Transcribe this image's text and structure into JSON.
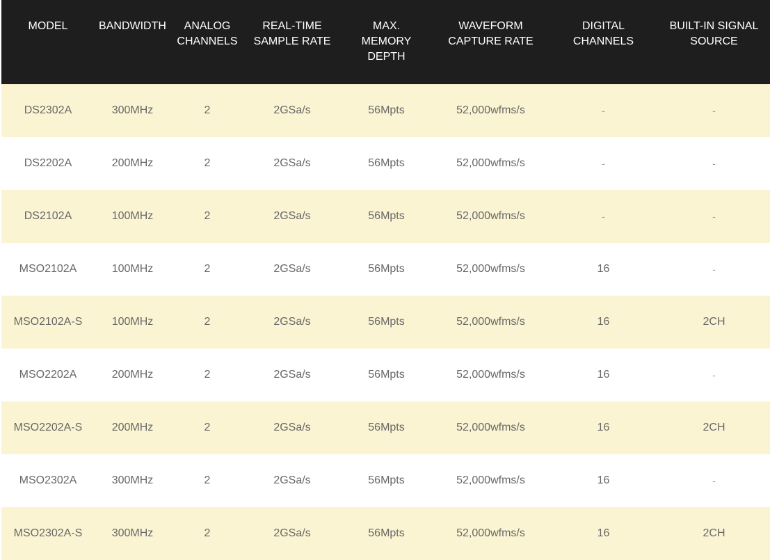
{
  "table": {
    "headers": [
      "MODEL",
      "BANDWIDTH",
      "ANALOG\nCHANNELS",
      "REAL-TIME\nSAMPLE RATE",
      "MAX.\nMEMORY\nDEPTH",
      "WAVEFORM\nCAPTURE RATE",
      "DIGITAL\nCHANNELS",
      "BUILT-IN SIGNAL\nSOURCE"
    ],
    "rows": [
      [
        "DS2302A",
        "300MHz",
        "2",
        "2GSa/s",
        "56Mpts",
        "52,000wfms/s",
        "-",
        "-"
      ],
      [
        "DS2202A",
        "200MHz",
        "2",
        "2GSa/s",
        "56Mpts",
        "52,000wfms/s",
        "-",
        "-"
      ],
      [
        "DS2102A",
        "100MHz",
        "2",
        "2GSa/s",
        "56Mpts",
        "52,000wfms/s",
        "-",
        "-"
      ],
      [
        "MSO2102A",
        "100MHz",
        "2",
        "2GSa/s",
        "56Mpts",
        "52,000wfms/s",
        "16",
        "-"
      ],
      [
        "MSO2102A-S",
        "100MHz",
        "2",
        "2GSa/s",
        "56Mpts",
        "52,000wfms/s",
        "16",
        "2CH"
      ],
      [
        "MSO2202A",
        "200MHz",
        "2",
        "2GSa/s",
        "56Mpts",
        "52,000wfms/s",
        "16",
        "-"
      ],
      [
        "MSO2202A-S",
        "200MHz",
        "2",
        "2GSa/s",
        "56Mpts",
        "52,000wfms/s",
        "16",
        "2CH"
      ],
      [
        "MSO2302A",
        "300MHz",
        "2",
        "2GSa/s",
        "56Mpts",
        "52,000wfms/s",
        "16",
        "-"
      ],
      [
        "MSO2302A-S",
        "300MHz",
        "2",
        "2GSa/s",
        "56Mpts",
        "52,000wfms/s",
        "16",
        "2CH"
      ]
    ]
  },
  "colors": {
    "header_bg": "#1e1e1e",
    "header_text": "#ffffff",
    "row_alt_bg": "#fbf4d2",
    "row_bg": "#ffffff",
    "cell_text": "#676767"
  }
}
